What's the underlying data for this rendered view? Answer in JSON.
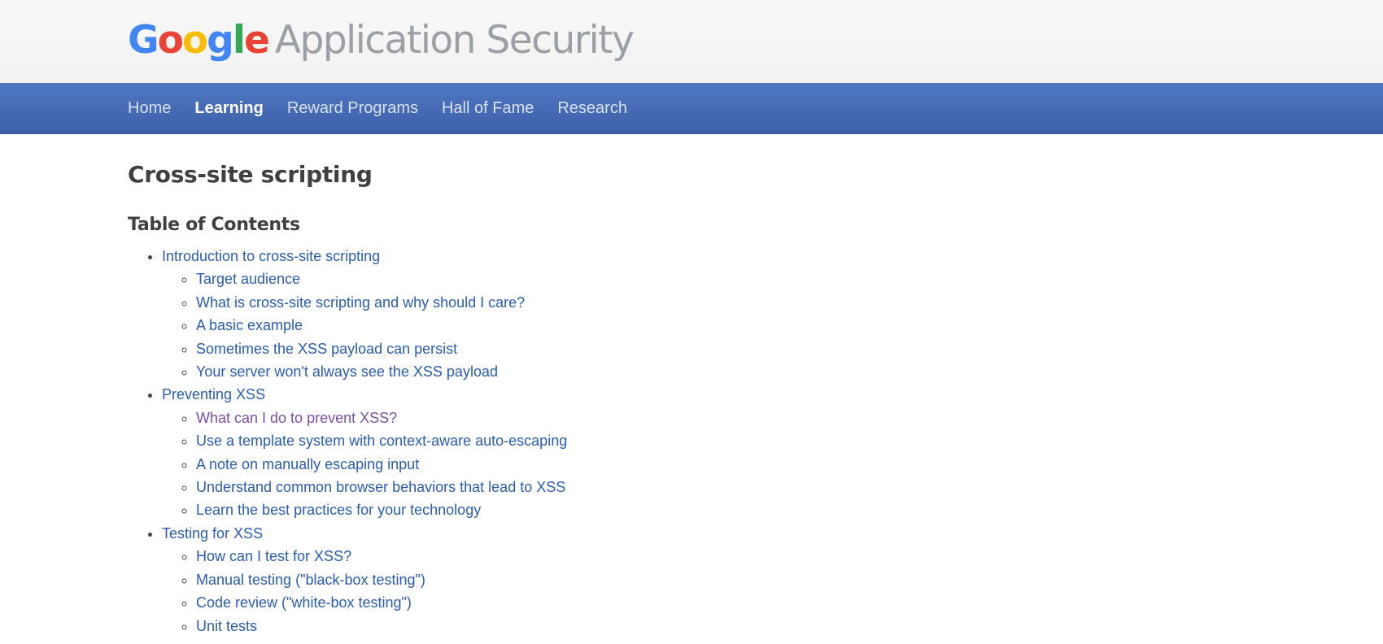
{
  "header": {
    "logo_letters": [
      "G",
      "o",
      "o",
      "g",
      "l",
      "e"
    ],
    "product_name": "Application Security"
  },
  "nav": {
    "items": [
      {
        "label": "Home",
        "active": false
      },
      {
        "label": "Learning",
        "active": true
      },
      {
        "label": "Reward Programs",
        "active": false
      },
      {
        "label": "Hall of Fame",
        "active": false
      },
      {
        "label": "Research",
        "active": false
      }
    ]
  },
  "colors": {
    "link": "#2a5db0",
    "visited_link": "#7b4fa6",
    "nav_bg": "#4a6fb8",
    "heading": "#404040"
  },
  "page": {
    "title": "Cross-site scripting",
    "toc_heading": "Table of Contents",
    "toc": [
      {
        "label": "Introduction to cross-site scripting",
        "children": [
          {
            "label": "Target audience"
          },
          {
            "label": "What is cross-site scripting and why should I care?"
          },
          {
            "label": "A basic example"
          },
          {
            "label": "Sometimes the XSS payload can persist"
          },
          {
            "label": "Your server won't always see the XSS payload"
          }
        ]
      },
      {
        "label": "Preventing XSS",
        "children": [
          {
            "label": "What can I do to prevent XSS?",
            "visited": true
          },
          {
            "label": "Use a template system with context-aware auto-escaping"
          },
          {
            "label": "A note on manually escaping input"
          },
          {
            "label": "Understand common browser behaviors that lead to XSS"
          },
          {
            "label": "Learn the best practices for your technology"
          }
        ]
      },
      {
        "label": "Testing for XSS",
        "children": [
          {
            "label": "How can I test for XSS?"
          },
          {
            "label": "Manual testing (\"black-box testing\")"
          },
          {
            "label": "Code review (\"white-box testing\")"
          },
          {
            "label": "Unit tests"
          }
        ]
      }
    ]
  }
}
